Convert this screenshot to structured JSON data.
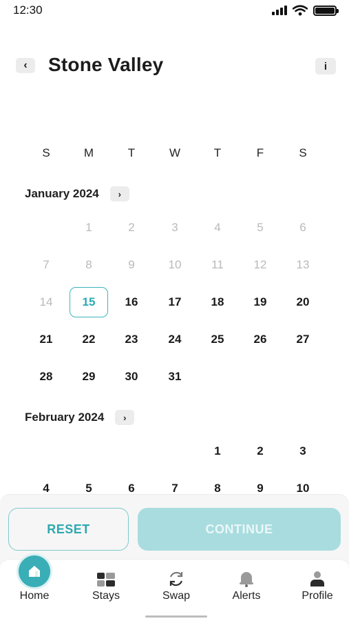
{
  "status_bar": {
    "time": "12:30"
  },
  "header": {
    "back_icon": "‹",
    "title": "Stone Valley",
    "info_icon": "i"
  },
  "weekdays": [
    "S",
    "M",
    "T",
    "W",
    "T",
    "F",
    "S"
  ],
  "months": [
    {
      "label": "January 2024",
      "chevron": "›",
      "weeks": [
        [
          null,
          {
            "d": "1",
            "s": "past"
          },
          {
            "d": "2",
            "s": "past"
          },
          {
            "d": "3",
            "s": "past"
          },
          {
            "d": "4",
            "s": "past"
          },
          {
            "d": "5",
            "s": "past"
          },
          {
            "d": "6",
            "s": "past"
          }
        ],
        [
          {
            "d": "7",
            "s": "past"
          },
          {
            "d": "8",
            "s": "past"
          },
          {
            "d": "9",
            "s": "past"
          },
          {
            "d": "10",
            "s": "past"
          },
          {
            "d": "11",
            "s": "past"
          },
          {
            "d": "12",
            "s": "past"
          },
          {
            "d": "13",
            "s": "past"
          }
        ],
        [
          {
            "d": "14",
            "s": "past"
          },
          {
            "d": "15",
            "s": "selected"
          },
          {
            "d": "16",
            "s": "active"
          },
          {
            "d": "17",
            "s": "active"
          },
          {
            "d": "18",
            "s": "active"
          },
          {
            "d": "19",
            "s": "active"
          },
          {
            "d": "20",
            "s": "active"
          }
        ],
        [
          {
            "d": "21",
            "s": "active"
          },
          {
            "d": "22",
            "s": "active"
          },
          {
            "d": "23",
            "s": "active"
          },
          {
            "d": "24",
            "s": "active"
          },
          {
            "d": "25",
            "s": "active"
          },
          {
            "d": "26",
            "s": "active"
          },
          {
            "d": "27",
            "s": "active"
          }
        ],
        [
          {
            "d": "28",
            "s": "active"
          },
          {
            "d": "29",
            "s": "active"
          },
          {
            "d": "30",
            "s": "active"
          },
          {
            "d": "31",
            "s": "active"
          },
          null,
          null,
          null
        ]
      ]
    },
    {
      "label": "February 2024",
      "chevron": "›",
      "weeks": [
        [
          null,
          null,
          null,
          null,
          {
            "d": "1",
            "s": "active"
          },
          {
            "d": "2",
            "s": "active"
          },
          {
            "d": "3",
            "s": "active"
          }
        ],
        [
          {
            "d": "4",
            "s": "active"
          },
          {
            "d": "5",
            "s": "active"
          },
          {
            "d": "6",
            "s": "active"
          },
          {
            "d": "7",
            "s": "active"
          },
          {
            "d": "8",
            "s": "active"
          },
          {
            "d": "9",
            "s": "active"
          },
          {
            "d": "10",
            "s": "active"
          }
        ]
      ]
    }
  ],
  "actions": {
    "reset_label": "RESET",
    "continue_label": "CONTINUE"
  },
  "tabs": [
    {
      "label": "Home",
      "icon": "home-icon",
      "active": true
    },
    {
      "label": "Stays",
      "icon": "stays-icon",
      "active": false
    },
    {
      "label": "Swap",
      "icon": "swap-icon",
      "active": false
    },
    {
      "label": "Alerts",
      "icon": "bell-icon",
      "active": false
    },
    {
      "label": "Profile",
      "icon": "profile-icon",
      "active": false
    }
  ],
  "colors": {
    "accent": "#3aaeb6",
    "accent_light": "#a9dcdf",
    "past_day": "#b9b9b9"
  }
}
